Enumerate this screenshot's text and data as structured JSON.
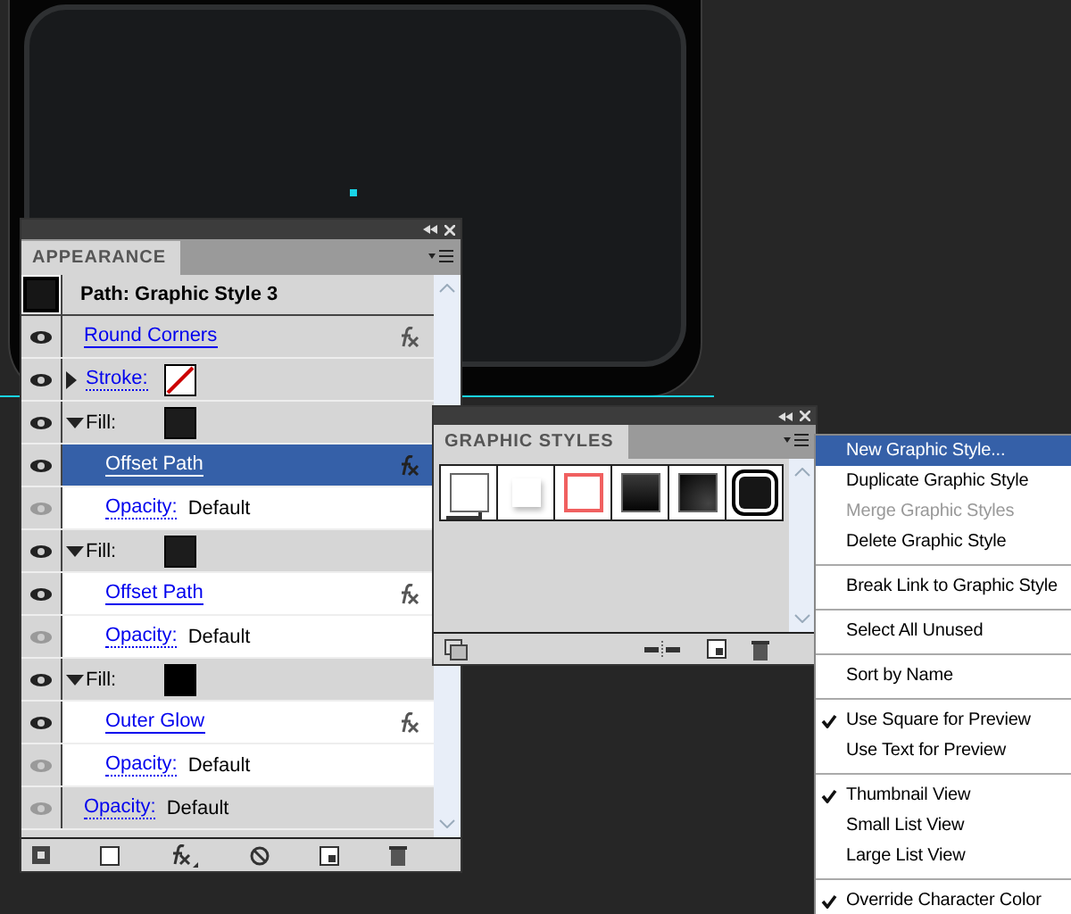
{
  "appearance": {
    "title": "APPEARANCE",
    "header": "Path: Graphic Style 3",
    "rows": [
      {
        "kind": "effect",
        "label": "Round Corners",
        "selected": false
      },
      {
        "kind": "stroke",
        "label": "Stroke:",
        "expanded": false,
        "selected": false
      },
      {
        "kind": "fill",
        "label": "Fill:",
        "color": "#1c1c1c",
        "expanded": true,
        "selected": false,
        "children": [
          {
            "kind": "effect",
            "label": "Offset Path",
            "selected": true
          },
          {
            "kind": "opacity",
            "label": "Opacity:",
            "value": "Default",
            "selected": false
          }
        ]
      },
      {
        "kind": "fill",
        "label": "Fill:",
        "color": "#1c1c1c",
        "expanded": true,
        "selected": false,
        "children": [
          {
            "kind": "effect",
            "label": "Offset Path",
            "selected": false
          },
          {
            "kind": "opacity",
            "label": "Opacity:",
            "value": "Default",
            "selected": false
          }
        ]
      },
      {
        "kind": "fill",
        "label": "Fill:",
        "color": "#000000",
        "expanded": true,
        "selected": false,
        "children": [
          {
            "kind": "effect",
            "label": "Outer Glow",
            "selected": false
          },
          {
            "kind": "opacity",
            "label": "Opacity:",
            "value": "Default",
            "selected": false
          }
        ]
      },
      {
        "kind": "opacity",
        "label": "Opacity:",
        "value": "Default",
        "selected": false
      }
    ]
  },
  "graphic_styles": {
    "title": "GRAPHIC STYLES",
    "swatches": [
      {
        "kind": "default",
        "selected": false
      },
      {
        "kind": "soft-white",
        "selected": false
      },
      {
        "kind": "red-outline",
        "selected": false
      },
      {
        "kind": "dark",
        "selected": false
      },
      {
        "kind": "dark-gradient",
        "selected": false
      },
      {
        "kind": "dark-rounded",
        "selected": true
      }
    ]
  },
  "menu": {
    "items": [
      {
        "kind": "item",
        "label": "New Graphic Style...",
        "selected": true,
        "disabled": false,
        "checked": false
      },
      {
        "kind": "item",
        "label": "Duplicate Graphic Style",
        "selected": false,
        "disabled": false,
        "checked": false
      },
      {
        "kind": "item",
        "label": "Merge Graphic Styles",
        "selected": false,
        "disabled": true,
        "checked": false
      },
      {
        "kind": "item",
        "label": "Delete Graphic Style",
        "selected": false,
        "disabled": false,
        "checked": false
      },
      {
        "kind": "separator"
      },
      {
        "kind": "item",
        "label": "Break Link to Graphic Style",
        "selected": false,
        "disabled": false,
        "checked": false
      },
      {
        "kind": "separator"
      },
      {
        "kind": "item",
        "label": "Select All Unused",
        "selected": false,
        "disabled": false,
        "checked": false
      },
      {
        "kind": "separator"
      },
      {
        "kind": "item",
        "label": "Sort by Name",
        "selected": false,
        "disabled": false,
        "checked": false
      },
      {
        "kind": "separator"
      },
      {
        "kind": "item",
        "label": "Use Square for Preview",
        "selected": false,
        "disabled": false,
        "checked": true
      },
      {
        "kind": "item",
        "label": "Use Text for Preview",
        "selected": false,
        "disabled": false,
        "checked": false
      },
      {
        "kind": "separator"
      },
      {
        "kind": "item",
        "label": "Thumbnail View",
        "selected": false,
        "disabled": false,
        "checked": true
      },
      {
        "kind": "item",
        "label": "Small List View",
        "selected": false,
        "disabled": false,
        "checked": false
      },
      {
        "kind": "item",
        "label": "Large List View",
        "selected": false,
        "disabled": false,
        "checked": false
      },
      {
        "kind": "separator"
      },
      {
        "kind": "item",
        "label": "Override Character Color",
        "selected": false,
        "disabled": false,
        "checked": true
      }
    ]
  }
}
